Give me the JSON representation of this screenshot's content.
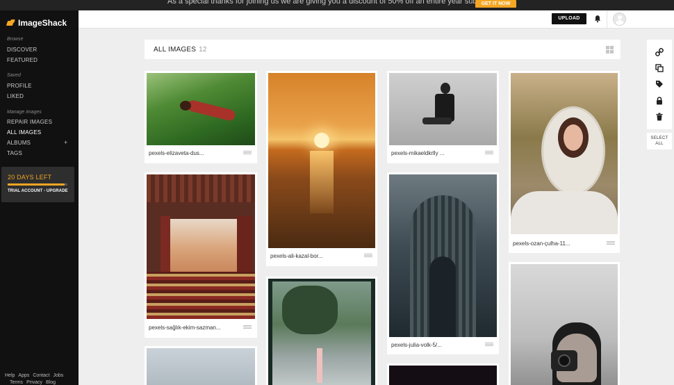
{
  "promo": {
    "text": "As a special thanks for joining us we are giving you a discount of 50% off an entire year subscription.",
    "button": "GET IT NOW",
    "accent": "#f5a623"
  },
  "brand": {
    "name": "ImageShack",
    "logo_icon": "imageshack-logo-icon"
  },
  "sidebar": {
    "browse_heading": "Browse",
    "browse_items": [
      "DISCOVER",
      "FEATURED"
    ],
    "saved_heading": "Saved",
    "saved_items": [
      "PROFILE",
      "LIKED"
    ],
    "manage_heading": "Manage images",
    "manage_items": [
      "REPAIR IMAGES",
      "ALL IMAGES",
      "ALBUMS",
      "TAGS"
    ],
    "active_item": "ALL IMAGES",
    "albums_add": "+",
    "trial": {
      "days_left": "20 DAYS LEFT",
      "cta": "TRIAL ACCOUNT - UPGRADE",
      "progress_fraction": 0.95
    },
    "footer": [
      "Help",
      "Apps",
      "Contact",
      "Jobs",
      "Terms",
      "Privacy",
      "Blog"
    ]
  },
  "header": {
    "upload": "UPLOAD",
    "bell_icon": "bell-icon",
    "avatar_icon": "user-avatar-icon"
  },
  "gallery": {
    "title": "ALL IMAGES",
    "count": "12",
    "view_icon": "grid-view-icon",
    "images": [
      {
        "caption": "pexels-elizaveta-dus..."
      },
      {
        "caption": "pexels-sağlık-ekim-sazman..."
      },
      {
        "caption": "pexels-ali-kazal-bor..."
      },
      {
        "caption": "pexels-mikaeldkrlly ..."
      },
      {
        "caption": "pexels-julia-volk-5/..."
      },
      {
        "caption": "pexels-ozan-çulha-11..."
      }
    ]
  },
  "toolbar": {
    "icons": [
      "link-icon",
      "copy-icon",
      "tag-icon",
      "lock-icon",
      "trash-icon"
    ],
    "select_all": "SELECT ALL"
  }
}
